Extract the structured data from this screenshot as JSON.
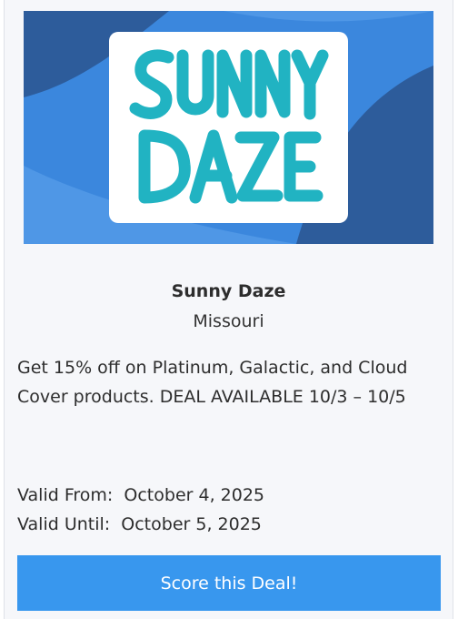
{
  "deal": {
    "logo_alt_text": "SUNNY DAZE",
    "brand_name": "Sunny Daze",
    "location": "Missouri",
    "description": "Get 15% off on Platinum, Galactic, and Cloud Cover products. DEAL AVAILABLE 10/3 – 10/5",
    "valid_from_label": "Valid From:",
    "valid_from_value": "October 4, 2025",
    "valid_until_label": "Valid Until:",
    "valid_until_value": "October 5, 2025",
    "cta_label": "Score this Deal!"
  },
  "colors": {
    "banner_blue": "#3b87dd",
    "banner_dark": "#2d5c9b",
    "logo_teal": "#21b3c2",
    "button_blue": "#3897ee"
  }
}
